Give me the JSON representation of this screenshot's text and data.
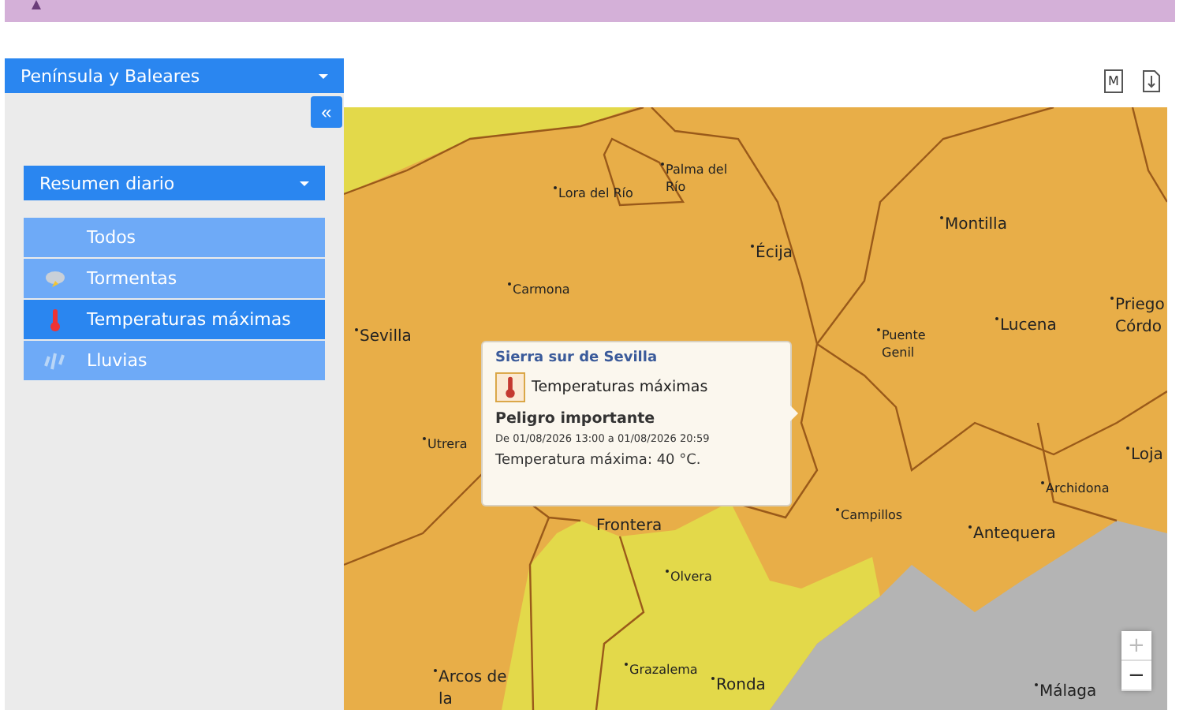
{
  "banner": {
    "kind": "warning"
  },
  "region_selector": {
    "label": "Península y Baleares"
  },
  "collapse_button": {
    "label": "«"
  },
  "summary_selector": {
    "label": "Resumen diario"
  },
  "phenomena": [
    {
      "label": "Todos",
      "kind": "all",
      "selected": false
    },
    {
      "label": "Tormentas",
      "kind": "storm",
      "selected": false
    },
    {
      "label": "Temperaturas máximas",
      "kind": "heat",
      "selected": true
    },
    {
      "label": "Lluvias",
      "kind": "rain",
      "selected": false
    }
  ],
  "toolbar": {
    "map_button": "M"
  },
  "map": {
    "places": [
      {
        "name": "Lora del Río",
        "kind": "town"
      },
      {
        "name": "Palma del Río",
        "kind": "town"
      },
      {
        "name": "Écija",
        "kind": "city"
      },
      {
        "name": "Montilla",
        "kind": "city"
      },
      {
        "name": "Carmona",
        "kind": "town"
      },
      {
        "name": "Sevilla",
        "kind": "city"
      },
      {
        "name": "Puente Genil",
        "kind": "town"
      },
      {
        "name": "Lucena",
        "kind": "city"
      },
      {
        "name": "Priego Córdo",
        "kind": "city"
      },
      {
        "name": "Utrera",
        "kind": "town"
      },
      {
        "name": "Archidona",
        "kind": "town"
      },
      {
        "name": "Campillos",
        "kind": "town"
      },
      {
        "name": "Antequera",
        "kind": "city"
      },
      {
        "name": "Loja",
        "kind": "city"
      },
      {
        "name": "Frontera",
        "kind": "label"
      },
      {
        "name": "Olvera",
        "kind": "town"
      },
      {
        "name": "Arcos de la",
        "kind": "city"
      },
      {
        "name": "Grazalema",
        "kind": "town"
      },
      {
        "name": "Ronda",
        "kind": "city"
      },
      {
        "name": "Málaga",
        "kind": "city"
      }
    ],
    "popup": {
      "zone": "Sierra sur de Sevilla",
      "phenomenon": "Temperaturas máximas",
      "danger": "Peligro importante",
      "period": "De 01/08/2026 13:00 a 01/08/2026 20:59",
      "detail": "Temperatura máxima: 40 °C."
    },
    "zoom": [
      {
        "label": "+",
        "disabled": true
      },
      {
        "label": "−",
        "disabled": false
      }
    ]
  }
}
